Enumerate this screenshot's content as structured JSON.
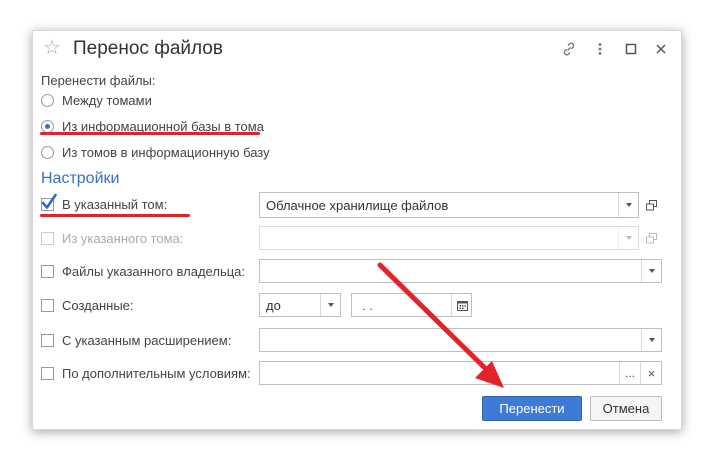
{
  "dialog": {
    "title": "Перенос файлов",
    "transfer_label": "Перенести файлы:",
    "radio_options": [
      {
        "label": "Между томами",
        "checked": false
      },
      {
        "label": "Из информационной базы в тома",
        "checked": true
      },
      {
        "label": "Из томов в информационную базу",
        "checked": false
      }
    ],
    "settings_title": "Настройки",
    "settings": {
      "to_volume": {
        "label": "В указанный том:",
        "checked": true,
        "value": "Облачное хранилище файлов"
      },
      "from_volume": {
        "label": "Из указанного тома:",
        "checked": false,
        "disabled": true,
        "value": ""
      },
      "owner_files": {
        "label": "Файлы указанного владельца:",
        "checked": false,
        "value": ""
      },
      "created": {
        "label": "Созданные:",
        "checked": false,
        "mode": "до",
        "date": " .  . "
      },
      "extension": {
        "label": "С указанным расширением:",
        "checked": false,
        "value": ""
      },
      "conditions": {
        "label": "По дополнительным условиям:",
        "checked": false,
        "value": "",
        "more": "...",
        "clear": "×"
      }
    },
    "buttons": {
      "transfer": "Перенести",
      "cancel": "Отмена"
    }
  },
  "icons": {
    "star": "star-icon",
    "link": "link-icon",
    "more": "more-vertical-icon",
    "maximize": "maximize-icon",
    "close": "close-icon"
  },
  "colors": {
    "accent": "#3a6fc7",
    "primary_button": "#3f7bd6",
    "annotation": "#e3222a"
  }
}
